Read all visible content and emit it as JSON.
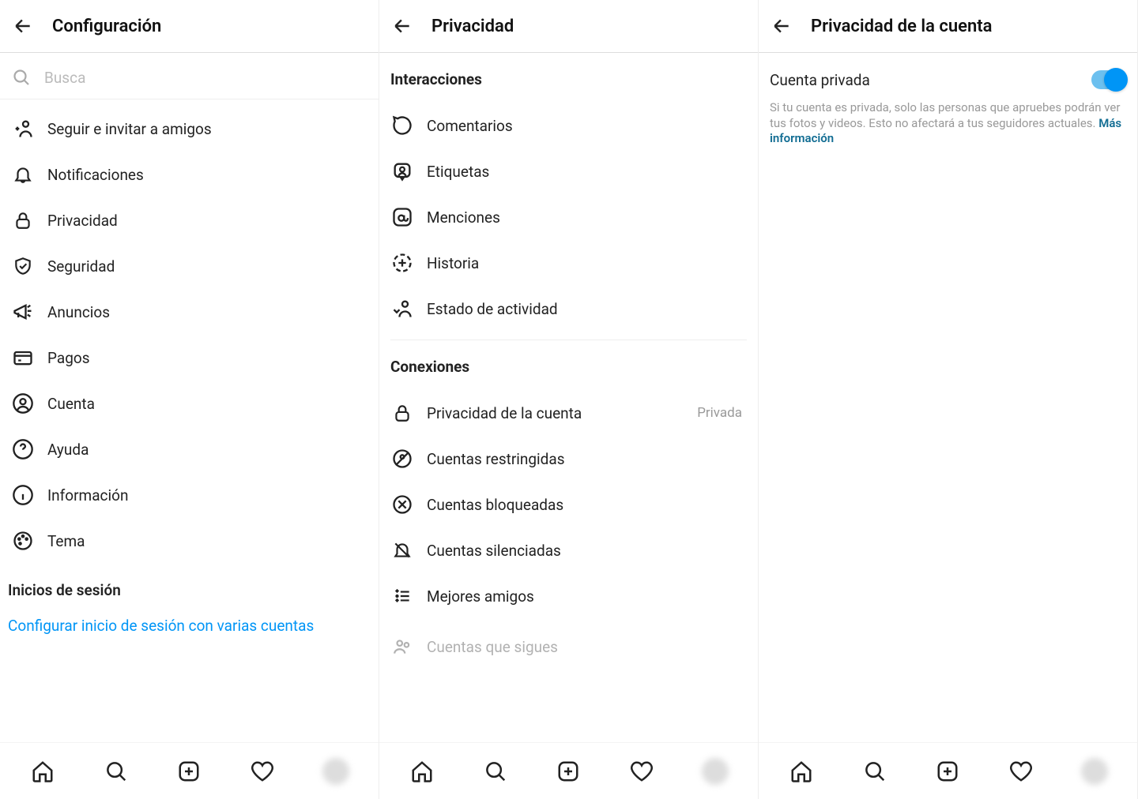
{
  "colors": {
    "link_blue": "#0095f6",
    "learn_more": "#126d93"
  },
  "panel1": {
    "title": "Configuración",
    "search_placeholder": "Busca",
    "items": [
      {
        "label": "Seguir e invitar a amigos"
      },
      {
        "label": "Notificaciones"
      },
      {
        "label": "Privacidad"
      },
      {
        "label": "Seguridad"
      },
      {
        "label": "Anuncios"
      },
      {
        "label": "Pagos"
      },
      {
        "label": "Cuenta"
      },
      {
        "label": "Ayuda"
      },
      {
        "label": "Información"
      },
      {
        "label": "Tema"
      }
    ],
    "logins_header": "Inicios de sesión",
    "multi_login": "Configurar inicio de sesión con varias cuentas"
  },
  "panel2": {
    "title": "Privacidad",
    "sections": {
      "interactions": {
        "header": "Interacciones",
        "items": [
          {
            "label": "Comentarios"
          },
          {
            "label": "Etiquetas"
          },
          {
            "label": "Menciones"
          },
          {
            "label": "Historia"
          },
          {
            "label": "Estado de actividad"
          }
        ]
      },
      "connections": {
        "header": "Conexiones",
        "items": [
          {
            "label": "Privacidad de la cuenta",
            "trailing": "Privada"
          },
          {
            "label": "Cuentas restringidas"
          },
          {
            "label": "Cuentas bloqueadas"
          },
          {
            "label": "Cuentas silenciadas"
          },
          {
            "label": "Mejores amigos"
          },
          {
            "label": "Cuentas que sigues"
          }
        ]
      }
    }
  },
  "panel3": {
    "title": "Privacidad de la cuenta",
    "toggle_label": "Cuenta privada",
    "toggle_on": true,
    "help_text": "Si tu cuenta es privada, solo las personas que apruebes podrán ver tus fotos y videos. Esto no afectará a tus seguidores actuales.",
    "learn_more": "Más información"
  }
}
